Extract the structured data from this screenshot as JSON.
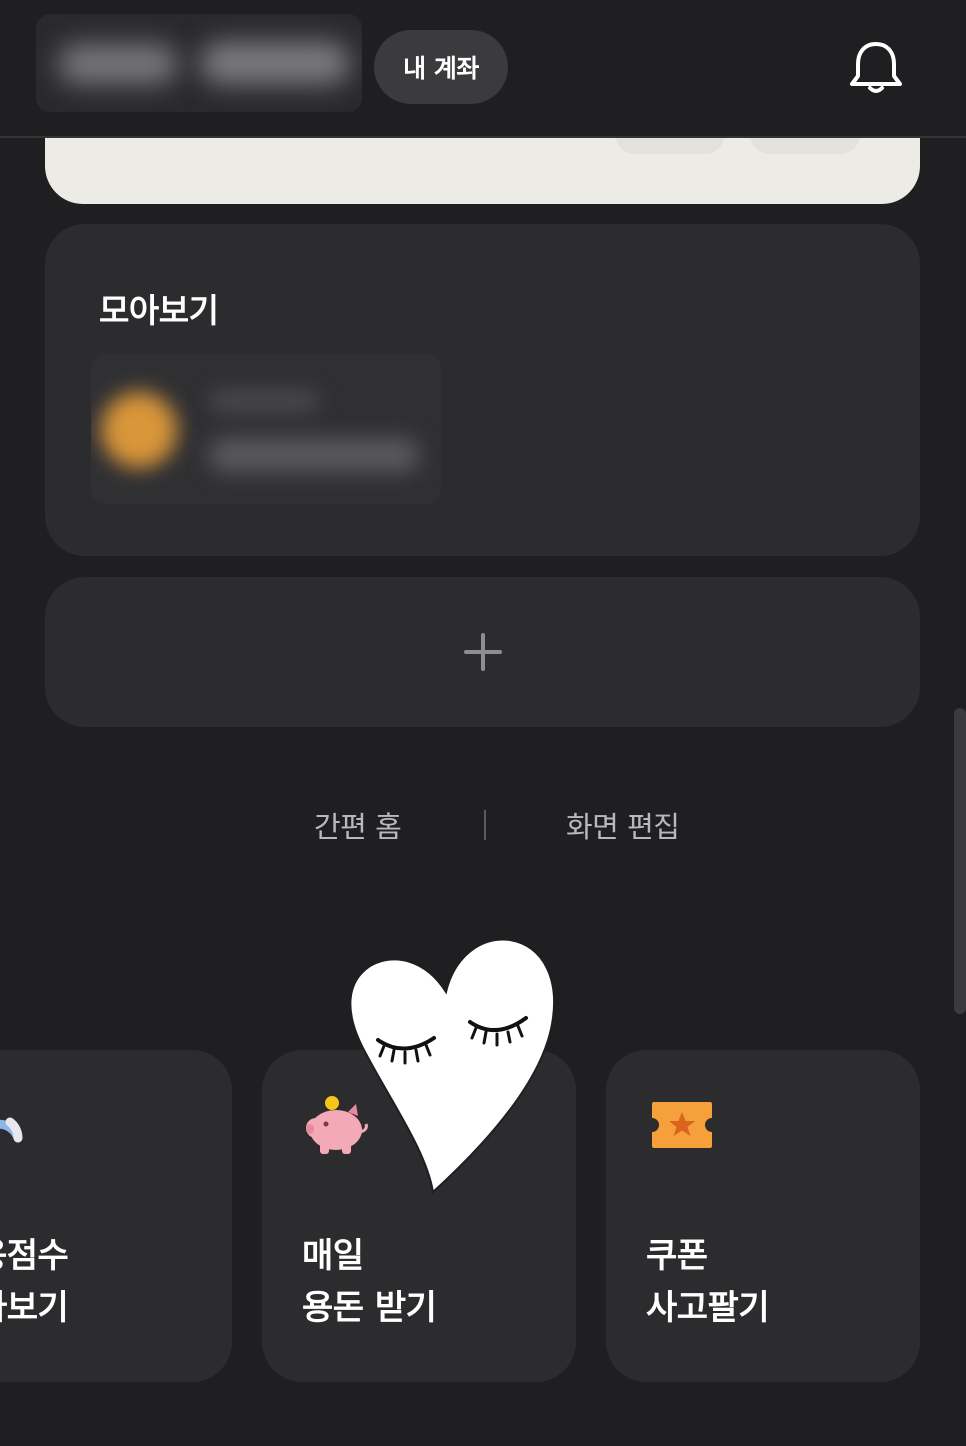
{
  "header": {
    "account_button": "내 계좌",
    "bell_icon": "bell-icon"
  },
  "collection": {
    "title": "모아보기"
  },
  "add_card": {
    "icon": "plus-icon"
  },
  "links": {
    "simple_home": "간편 홈",
    "edit_screen": "화면 편집"
  },
  "tiles": [
    {
      "icon": "gauge-icon",
      "line1": "용점수",
      "line2": "아보기"
    },
    {
      "icon": "piggy-bank-icon",
      "line1": "매일",
      "line2": "용돈 받기"
    },
    {
      "icon": "ticket-star-icon",
      "line1": "쿠폰",
      "line2": "사고팔기"
    }
  ],
  "colors": {
    "background": "#1f1f21",
    "card": "#2c2c2e",
    "top_card": "#ecebe6",
    "pill": "#3b3b3e",
    "ticket": "#f5a03a",
    "piggy": "#f3a9b6",
    "gauge": "#8fb5e8"
  },
  "sticker": "heart-sticker"
}
